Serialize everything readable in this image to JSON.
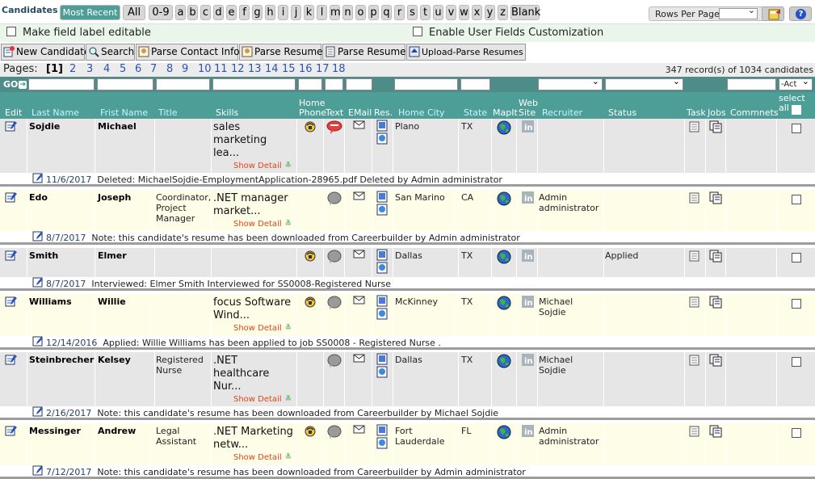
{
  "filterbar": {
    "title": "Candidates",
    "tabs": [
      "Most Recent",
      "All",
      "0-9",
      "a",
      "b",
      "c",
      "d",
      "e",
      "f",
      "g",
      "h",
      "i",
      "j",
      "k",
      "l",
      "m",
      "n",
      "o",
      "p",
      "q",
      "r",
      "s",
      "t",
      "u",
      "v",
      "w",
      "x",
      "y",
      "z",
      "Blank"
    ],
    "rows_per_page_label": "Rows Per Page:"
  },
  "options": {
    "editable_label": "Make field label editable",
    "user_fields": "Enable User Fields Customization"
  },
  "toolbar": {
    "new_candidate": "New Candidate",
    "search": "Search",
    "parse_contact": "Parse Contact Info",
    "parse_resume_1": "Parse Resume",
    "parse_resume_2": "Parse Resume",
    "upload_parse": "Upload-Parse Resumes"
  },
  "pagination": {
    "label": "Pages:",
    "current": "[1]",
    "pages": [
      "2",
      "3",
      "4",
      "5",
      "6",
      "7",
      "8",
      "9",
      "10",
      "11",
      "12",
      "13",
      "14",
      "15",
      "16",
      "17",
      "18"
    ],
    "records": "347 record(s) of 1034 candidates"
  },
  "filters": {
    "go": "GO",
    "act": "-Act"
  },
  "columns": {
    "edit": "Edit",
    "last_name": "Last Name",
    "first_name": "Frist Name",
    "title": "Title",
    "skills": "Skills",
    "home_phone": "Home Phone",
    "text": "Text",
    "email": "EMail",
    "res": "Res.",
    "home_city": "Home City",
    "state": "State",
    "mapit": "MapIt",
    "website": "Web Site",
    "recruiter": "Recruiter",
    "status": "Status",
    "task": "Task",
    "jobs": "Jobs",
    "comments": "Commnets",
    "select_all": "select all"
  },
  "show_detail": "Show Detail",
  "candidates": [
    {
      "last": "Sojdie",
      "first": "Michael",
      "title": "",
      "skills": [
        "sales",
        "marketing",
        "lea..."
      ],
      "city": "Plano",
      "state": "TX",
      "recruiter": "",
      "status": "",
      "phone_icon": true,
      "text_color": "red",
      "note_date": "11/6/2017",
      "note": "Deleted: MichaelSojdie-EmploymentApplication-28965.pdf Deleted by Admin administrator"
    },
    {
      "last": "Edo",
      "first": "Joseph",
      "title": "Coordinator, Project Manager",
      "skills": [
        ".NET manager",
        "market..."
      ],
      "city": "San Marino",
      "state": "CA",
      "recruiter": "Admin administrator",
      "status": "",
      "phone_icon": false,
      "text_color": "gray",
      "note_date": "8/7/2017",
      "note": "Note: this candidate's resume has been downloaded from Careerbuilder by Admin administrator"
    },
    {
      "last": "Smith",
      "first": "Elmer",
      "title": "",
      "skills": [],
      "city": "Dallas",
      "state": "TX",
      "recruiter": "",
      "status": "Applied",
      "phone_icon": true,
      "text_color": "gray",
      "note_date": "8/7/2017",
      "note": "Interviewed: Elmer Smith Interviewed for SS0008-Registered Nurse"
    },
    {
      "last": "Williams",
      "first": "Willie",
      "title": "",
      "skills": [
        "focus Software",
        "Wind..."
      ],
      "city": "McKinney",
      "state": "TX",
      "recruiter": "Michael Sojdie",
      "status": "",
      "phone_icon": true,
      "text_color": "gray",
      "note_date": "12/14/2016",
      "note": "Applied: Willie Williams has been applied to job SS0008 - Registered Nurse ."
    },
    {
      "last": "Steinbrecher",
      "first": "Kelsey",
      "title": "Registered Nurse",
      "skills": [
        ".NET",
        "healthcare",
        "Nur..."
      ],
      "city": "Dallas",
      "state": "TX",
      "recruiter": "Michael Sojdie",
      "status": "",
      "phone_icon": false,
      "text_color": "gray",
      "note_date": "2/16/2017",
      "note": "Note: this candidate's resume has been downloaded from Careerbuilder by Michael Sojdie"
    },
    {
      "last": "Messinger",
      "first": "Andrew",
      "title": "Legal Assistant",
      "skills": [
        ".NET Marketing",
        "netw..."
      ],
      "city": "Fort Lauderdale",
      "state": "FL",
      "recruiter": "Admin administrator",
      "status": "",
      "phone_icon": true,
      "text_color": "gray",
      "note_date": "7/12/2017",
      "note": "Note: this candidate's resume has been downloaded from Careerbuilder by Admin administrator"
    }
  ]
}
